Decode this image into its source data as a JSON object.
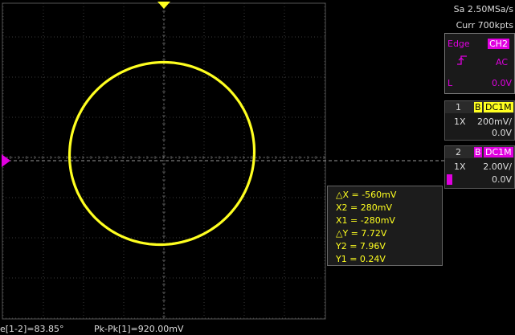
{
  "acquisition": {
    "sample_rate": "Sa 2.50MSa/s",
    "memory": "Curr 700kpts"
  },
  "trigger": {
    "mode": "Edge",
    "source": "CH2",
    "slope_icon": "rising-edge-icon",
    "coupling": "AC",
    "level_label": "L",
    "level": "0.0V"
  },
  "channels": [
    {
      "number": "1",
      "bw_label": "B",
      "coupling": "DC1M",
      "probe": "1X",
      "scale": "200mV/",
      "offset": "0.0V",
      "color": "#ffff20"
    },
    {
      "number": "2",
      "bw_label": "B",
      "coupling": "DC1M",
      "probe": "1X",
      "scale": "2.00V/",
      "offset": "0.0V",
      "color": "#e000e0",
      "marker": "I"
    }
  ],
  "cursors": {
    "dx": "△X = -560mV",
    "x2": "X2 = 280mV",
    "x1": "X1 = -280mV",
    "dy": "△Y = 7.72V",
    "y2": "Y2 = 7.96V",
    "y1": "Y1 = 0.24V"
  },
  "measurements": {
    "phase": "e[1-2]=83.85°",
    "pk_pk": "Pk-Pk[1]=920.00mV"
  },
  "colors": {
    "trace": "#ffff20",
    "ch2": "#e000e0",
    "grid": "#3a3a3a",
    "cursor_panel": "#1c1c1c"
  },
  "trace": {
    "type": "xy_lissajous",
    "x_center_divs": -0.05,
    "y_center_divs": 0.1,
    "x_radius_divs": 2.35,
    "y_radius_divs": 2.27,
    "tilt_deg": 12
  }
}
